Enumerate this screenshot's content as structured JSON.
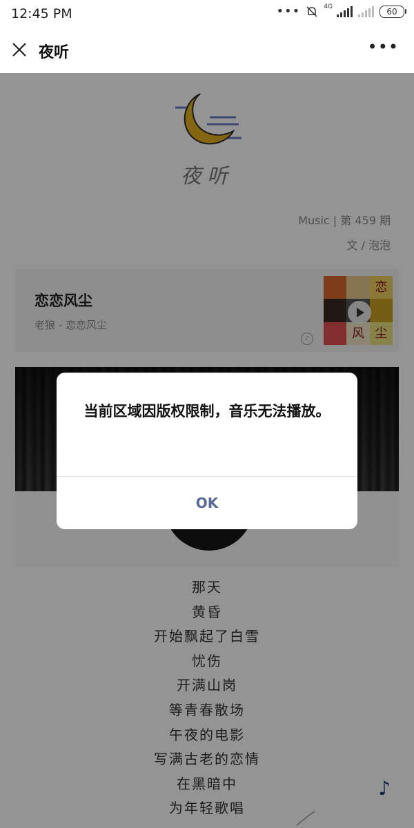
{
  "status_bar": {
    "time": "12:45 PM",
    "network": "4G",
    "battery": "60"
  },
  "nav": {
    "title": "夜听",
    "close_icon": "close-icon",
    "more_icon": "more-icon"
  },
  "article": {
    "logo_text": "夜听",
    "issue": "Music | 第 459 期",
    "author": "文 / 泡泡",
    "music": {
      "title": "恋恋风尘",
      "artist": "老狼 - 恋恋风尘",
      "album_chars": [
        "恋",
        "风",
        "尘"
      ]
    },
    "lyrics": [
      "那天",
      "黄昏",
      "开始飘起了白雪",
      "忧伤",
      "开满山岗",
      "等青春散场",
      "午夜的电影",
      "写满古老的恋情",
      "在黑暗中",
      "为年轻歌唱"
    ]
  },
  "dialog": {
    "message": "当前区域因版权限制，音乐无法播放。",
    "ok_label": "OK"
  },
  "colors": {
    "dialog_button": "#576b95",
    "overlay": "rgba(0,0,0,0.42)",
    "music_note": "#1e3a6e"
  }
}
